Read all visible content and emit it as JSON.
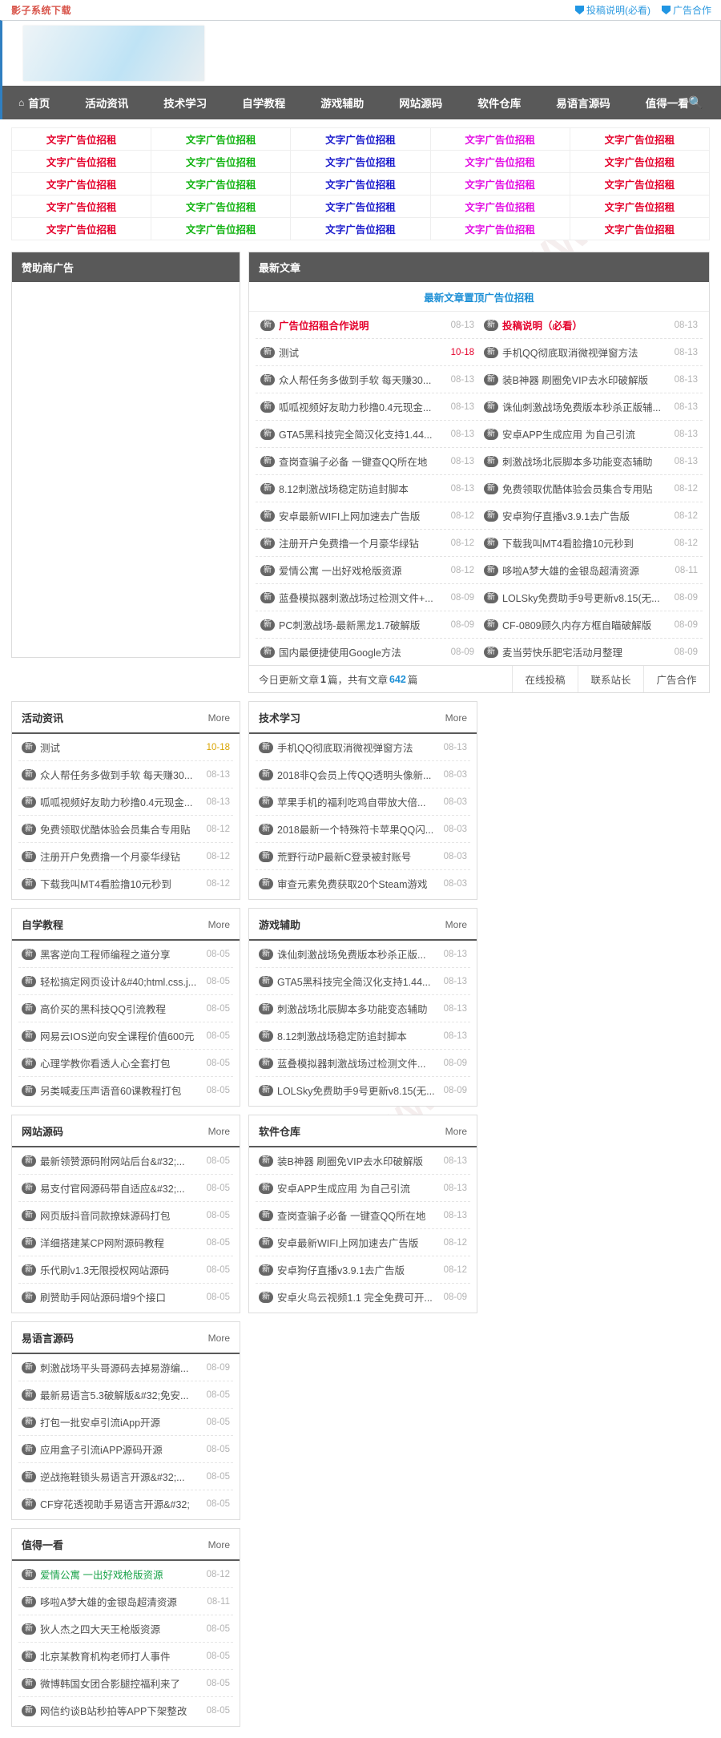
{
  "topbar": {
    "site_name": "影子系统下载",
    "links": [
      {
        "label": "投稿说明(必看)",
        "icon": "shield-icon"
      },
      {
        "label": "广告合作",
        "icon": "shield-icon"
      }
    ]
  },
  "nav": {
    "home_icon": "home-icon",
    "search_icon": "search-icon",
    "items": [
      {
        "label": "首页"
      },
      {
        "label": "活动资讯"
      },
      {
        "label": "技术学习"
      },
      {
        "label": "自学教程"
      },
      {
        "label": "游戏辅助"
      },
      {
        "label": "网站源码"
      },
      {
        "label": "软件仓库"
      },
      {
        "label": "易语言源码"
      },
      {
        "label": "值得一看"
      }
    ]
  },
  "text_ads": {
    "label": "文字广告位招租",
    "colors": [
      "#e4002b",
      "#12b312",
      "#1a1acc",
      "#e30ee3",
      "#e4002b"
    ],
    "rows": 5,
    "cols": 5
  },
  "sponsor": {
    "title": "赞助商广告"
  },
  "latest": {
    "title": "最新文章",
    "top_ad": "最新文章置顶广告位招租",
    "badge": "新",
    "rows": [
      [
        {
          "title": "广告位招租合作说明",
          "date": "08-13",
          "highlight": true
        },
        {
          "title": "投稿说明（必看）",
          "date": "08-13",
          "highlight": true
        }
      ],
      [
        {
          "title": "测试",
          "date": "10-18",
          "date_red": true
        },
        {
          "title": "手机QQ彻底取消微视弹窗方法",
          "date": "08-13"
        }
      ],
      [
        {
          "title": "众人帮任务多做到手软 每天赚30...",
          "date": "08-13"
        },
        {
          "title": "装B神器 刷圈免VIP去水印破解版",
          "date": "08-13"
        }
      ],
      [
        {
          "title": "呱呱视频好友助力秒撸0.4元现金...",
          "date": "08-13"
        },
        {
          "title": "诛仙刺激战场免费版本秒杀正版辅...",
          "date": "08-13"
        }
      ],
      [
        {
          "title": "GTA5黑科技完全简汉化支持1.44...",
          "date": "08-13"
        },
        {
          "title": "安卓APP生成应用 为自己引流",
          "date": "08-13"
        }
      ],
      [
        {
          "title": "查岗查骗子必备 一键查QQ所在地",
          "date": "08-13"
        },
        {
          "title": "刺激战场北辰脚本多功能变态辅助",
          "date": "08-13"
        }
      ],
      [
        {
          "title": "8.12刺激战场稳定防追封脚本",
          "date": "08-13"
        },
        {
          "title": "免费领取优酷体验会员集合专用贴",
          "date": "08-12"
        }
      ],
      [
        {
          "title": "安卓最新WIFI上网加速去广告版",
          "date": "08-12"
        },
        {
          "title": "安卓狗仔直播v3.9.1去广告版",
          "date": "08-12"
        }
      ],
      [
        {
          "title": "注册开户免费撸一个月豪华绿钻",
          "date": "08-12"
        },
        {
          "title": "下载我叫MT4看脸撸10元秒到",
          "date": "08-12"
        }
      ],
      [
        {
          "title": "爱情公寓 一出好戏枪版资源",
          "date": "08-12"
        },
        {
          "title": "哆啦A梦大雄的金银岛超清资源",
          "date": "08-11"
        }
      ],
      [
        {
          "title": "蓝叠模拟器刺激战场过检测文件+...",
          "date": "08-09"
        },
        {
          "title": "LOLSky免费助手9号更新v8.15(无...",
          "date": "08-09"
        }
      ],
      [
        {
          "title": "PC刺激战场-最新黑龙1.7破解版",
          "date": "08-09"
        },
        {
          "title": "CF-0809顾久内存方框自瞄破解版",
          "date": "08-09"
        }
      ],
      [
        {
          "title": "国内最便捷使用Google方法",
          "date": "08-09"
        },
        {
          "title": "麦当劳快乐肥宅活动月整理",
          "date": "08-09"
        }
      ]
    ],
    "footer": {
      "prefix": "今日更新文章 ",
      "today_count": "1",
      "middle": " 篇，共有文章 ",
      "total_count": "642",
      "suffix": " 篇",
      "buttons": [
        "在线投稿",
        "联系站长",
        "广告合作"
      ]
    }
  },
  "categories": [
    {
      "title": "活动资讯",
      "more": "More",
      "items": [
        {
          "title": "测试",
          "date": "10-18",
          "date_red": true
        },
        {
          "title": "众人帮任务多做到手软 每天赚30...",
          "date": "08-13"
        },
        {
          "title": "呱呱视频好友助力秒撸0.4元现金...",
          "date": "08-13"
        },
        {
          "title": "免费领取优酷体验会员集合专用贴",
          "date": "08-12"
        },
        {
          "title": "注册开户免费撸一个月豪华绿钻",
          "date": "08-12"
        },
        {
          "title": "下载我叫MT4看脸撸10元秒到",
          "date": "08-12"
        }
      ]
    },
    {
      "title": "技术学习",
      "more": "More",
      "items": [
        {
          "title": "手机QQ彻底取消微视弹窗方法",
          "date": "08-13"
        },
        {
          "title": "2018非Q会员上传QQ透明头像新...",
          "date": "08-03"
        },
        {
          "title": "苹果手机的福利吃鸡自带放大倍...",
          "date": "08-03"
        },
        {
          "title": "2018最新一个特殊符卡苹果QQ闪...",
          "date": "08-03"
        },
        {
          "title": "荒野行动P最新C登录被封账号",
          "date": "08-03"
        },
        {
          "title": "审查元素免费获取20个Steam游戏",
          "date": "08-03"
        }
      ]
    },
    {
      "title": "自学教程",
      "more": "More",
      "items": [
        {
          "title": "黑客逆向工程师编程之道分享",
          "date": "08-05"
        },
        {
          "title": "轻松搞定网页设计&#40;html.css.j...",
          "date": "08-05"
        },
        {
          "title": "高价买的黑科技QQ引流教程",
          "date": "08-05"
        },
        {
          "title": "网易云IOS逆向安全课程价值600元",
          "date": "08-05"
        },
        {
          "title": "心理学教你看透人心全套打包",
          "date": "08-05"
        },
        {
          "title": "另类喊麦压声语音60课教程打包",
          "date": "08-05"
        }
      ]
    },
    {
      "title": "游戏辅助",
      "more": "More",
      "items": [
        {
          "title": "诛仙刺激战场免费版本秒杀正版...",
          "date": "08-13"
        },
        {
          "title": "GTA5黑科技完全简汉化支持1.44...",
          "date": "08-13"
        },
        {
          "title": "刺激战场北辰脚本多功能变态辅助",
          "date": "08-13"
        },
        {
          "title": "8.12刺激战场稳定防追封脚本",
          "date": "08-13"
        },
        {
          "title": "蓝叠模拟器刺激战场过检测文件...",
          "date": "08-09"
        },
        {
          "title": "LOLSky免费助手9号更新v8.15(无...",
          "date": "08-09"
        }
      ]
    },
    {
      "title": "网站源码",
      "more": "More",
      "items": [
        {
          "title": "最新领赞源码附网站后台&#32;...",
          "date": "08-05"
        },
        {
          "title": "易支付官网源码带自适应&#32;...",
          "date": "08-05"
        },
        {
          "title": "网页版抖音同款撩妹源码打包",
          "date": "08-05"
        },
        {
          "title": "洋细搭建某CP网附源码教程",
          "date": "08-05"
        },
        {
          "title": "乐代刷v1.3无限授权网站源码",
          "date": "08-05"
        },
        {
          "title": "刷赞助手网站源码增9个接口",
          "date": "08-05"
        }
      ]
    },
    {
      "title": "软件仓库",
      "more": "More",
      "items": [
        {
          "title": "装B神器 刷圈免VIP去水印破解版",
          "date": "08-13"
        },
        {
          "title": "安卓APP生成应用 为自己引流",
          "date": "08-13"
        },
        {
          "title": "查岗查骗子必备 一键查QQ所在地",
          "date": "08-13"
        },
        {
          "title": "安卓最新WIFI上网加速去广告版",
          "date": "08-12"
        },
        {
          "title": "安卓狗仔直播v3.9.1去广告版",
          "date": "08-12"
        },
        {
          "title": "安卓火鸟云视频1.1 完全免费可开...",
          "date": "08-09"
        }
      ]
    },
    {
      "title": "易语言源码",
      "more": "More",
      "items": [
        {
          "title": "刺激战场平头哥源码去掉易游编...",
          "date": "08-09"
        },
        {
          "title": "最新易语言5.3破解版&#32;免安...",
          "date": "08-05"
        },
        {
          "title": "打包一批安卓引流iApp开源",
          "date": "08-05"
        },
        {
          "title": "应用盒子引流iAPP源码开源",
          "date": "08-05"
        },
        {
          "title": "逆战拖鞋锁头易语言开源&#32;...",
          "date": "08-05"
        },
        {
          "title": "CF穿花透视助手易语言开源&#32;",
          "date": "08-05"
        }
      ]
    },
    {
      "title": "值得一看",
      "more": "More",
      "items": [
        {
          "title": "爱情公寓 一出好戏枪版资源",
          "date": "08-12",
          "green": true
        },
        {
          "title": "哆啦A梦大雄的金银岛超清资源",
          "date": "08-11"
        },
        {
          "title": "狄人杰之四大天王枪版资源",
          "date": "08-05"
        },
        {
          "title": "北京某教育机构老师打人事件",
          "date": "08-05"
        },
        {
          "title": "微博韩国女团合影腿控福利来了",
          "date": "08-05"
        },
        {
          "title": "网信约谈B站秒拍等APP下架整改",
          "date": "08-05"
        }
      ]
    }
  ],
  "watermarks": [
    "WWW.",
    "WWW",
    "影子像",
    "WWW",
    "WWW"
  ]
}
